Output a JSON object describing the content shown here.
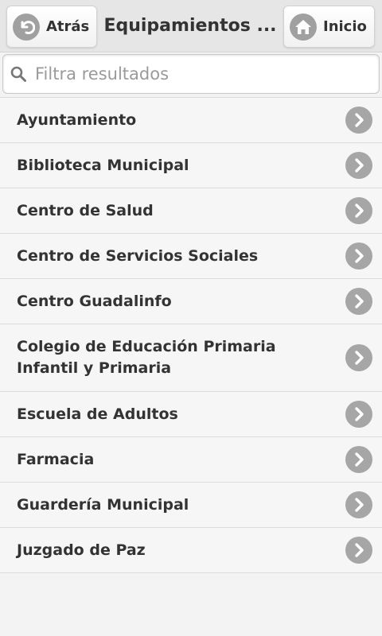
{
  "header": {
    "back_label": "Atrás",
    "title": "Equipamientos ...",
    "home_label": "Inicio"
  },
  "search": {
    "placeholder": "Filtra resultados",
    "value": ""
  },
  "list": {
    "items": [
      {
        "lines": [
          "Ayuntamiento"
        ]
      },
      {
        "lines": [
          "Biblioteca Municipal"
        ]
      },
      {
        "lines": [
          "Centro de Salud"
        ]
      },
      {
        "lines": [
          "Centro de Servicios Sociales"
        ]
      },
      {
        "lines": [
          "Centro Guadalinfo"
        ]
      },
      {
        "lines": [
          "Colegio de Educación Primaria",
          "Infantil y Primaria"
        ]
      },
      {
        "lines": [
          "Escuela de Adultos"
        ]
      },
      {
        "lines": [
          "Farmacia"
        ]
      },
      {
        "lines": [
          "Guardería Municipal"
        ]
      },
      {
        "lines": [
          "Juzgado de Paz"
        ]
      }
    ]
  },
  "icons": {
    "back": "back-arrow-icon",
    "home": "home-icon",
    "search": "search-icon",
    "row": "chevron-right-icon"
  },
  "colors": {
    "icon_fill": "#a6a6a6",
    "row_background": "#f6f6f6",
    "header_background": "#e6e6e6"
  }
}
